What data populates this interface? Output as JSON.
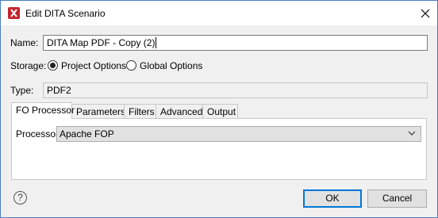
{
  "window": {
    "title": "Edit DITA Scenario"
  },
  "name": {
    "label": "Name:",
    "value": "DITA Map PDF - Copy (2)"
  },
  "storage": {
    "label": "Storage:",
    "options": [
      {
        "label": "Project Options",
        "selected": true
      },
      {
        "label": "Global Options",
        "selected": false
      }
    ]
  },
  "type": {
    "label": "Type:",
    "value": "PDF2"
  },
  "tabs": [
    "FO Processor",
    "Parameters",
    "Filters",
    "Advanced",
    "Output"
  ],
  "processor": {
    "label": "Processor:",
    "value": "Apache FOP"
  },
  "buttons": {
    "ok": "OK",
    "cancel": "Cancel",
    "help": "?"
  }
}
